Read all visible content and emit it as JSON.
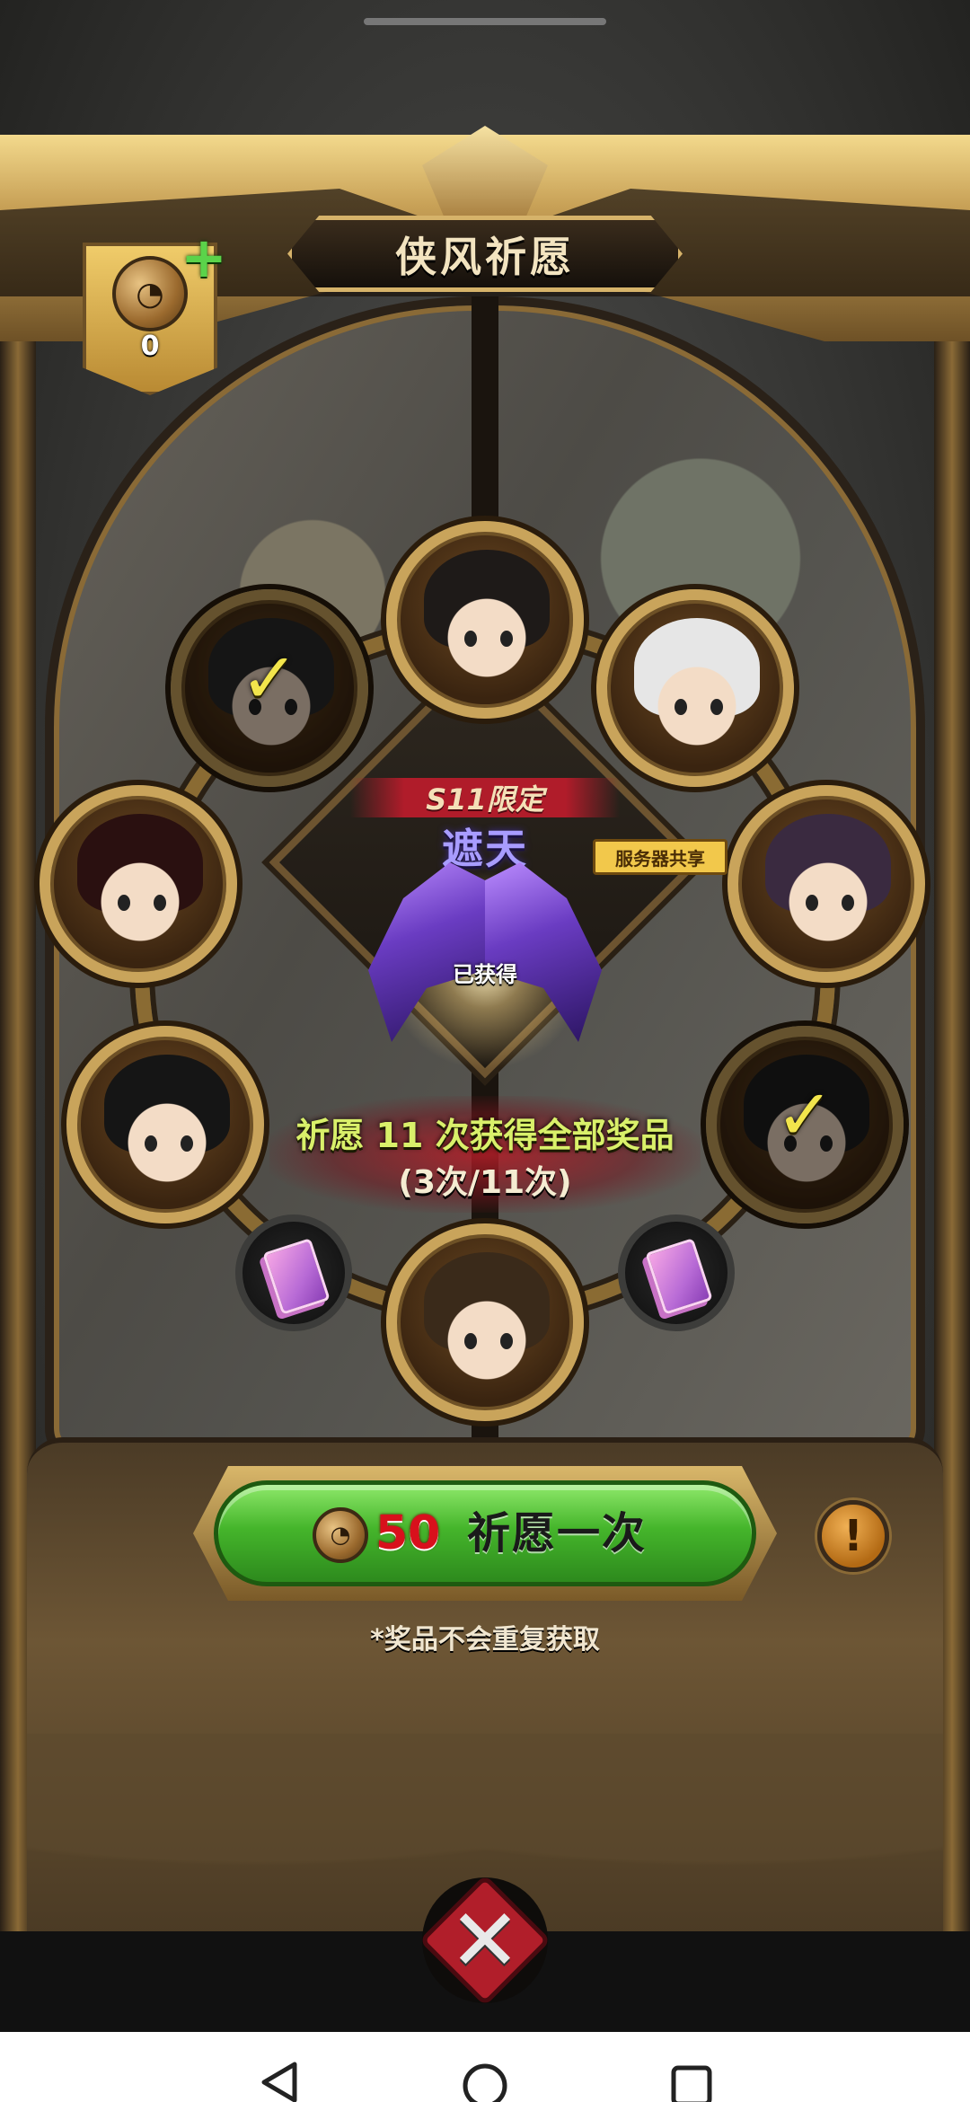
{
  "title": "侠风祈愿",
  "currency": {
    "count": "0",
    "add_symbol": "+",
    "icon": "wind-coin-icon"
  },
  "banner": {
    "season_tag": "S11限定",
    "item_name": "遮天",
    "item_icon": "purple-wings-icon",
    "shared_tag": "服务器共享",
    "obtained_label": "已获得"
  },
  "progress": {
    "line1": "祈愿 11 次获得全部奖品",
    "line2": "(3次/11次)",
    "done": 3,
    "total": 11
  },
  "prizes": [
    {
      "name": "portrait-top",
      "obtained": false,
      "hair": "#1e1a18"
    },
    {
      "name": "portrait-top-left",
      "obtained": true,
      "hair": "#2a2a2a"
    },
    {
      "name": "portrait-top-right",
      "obtained": false,
      "hair": "#e6e6e6"
    },
    {
      "name": "portrait-left",
      "obtained": false,
      "hair": "#2a1010"
    },
    {
      "name": "portrait-right",
      "obtained": false,
      "hair": "#3a2a40"
    },
    {
      "name": "portrait-bottom-left",
      "obtained": false,
      "hair": "#151515"
    },
    {
      "name": "portrait-bottom-right",
      "obtained": true,
      "hair": "#1e1e1e"
    },
    {
      "name": "portrait-bottom",
      "obtained": false,
      "hair": "#3a2a1a"
    }
  ],
  "check_mark": "✓",
  "wish_button": {
    "cost": "50",
    "label": "祈愿一次"
  },
  "info_button": {
    "glyph": "!"
  },
  "note": "*奖品不会重复获取",
  "close_button": {
    "glyph": "✕"
  },
  "nav": {
    "back": "◁",
    "home": "○",
    "recents": "□"
  },
  "colors": {
    "accent_gold": "#c9a45b",
    "button_green": "#45b52b",
    "cost_red": "#d8101c",
    "name_purple": "#a89cff"
  }
}
